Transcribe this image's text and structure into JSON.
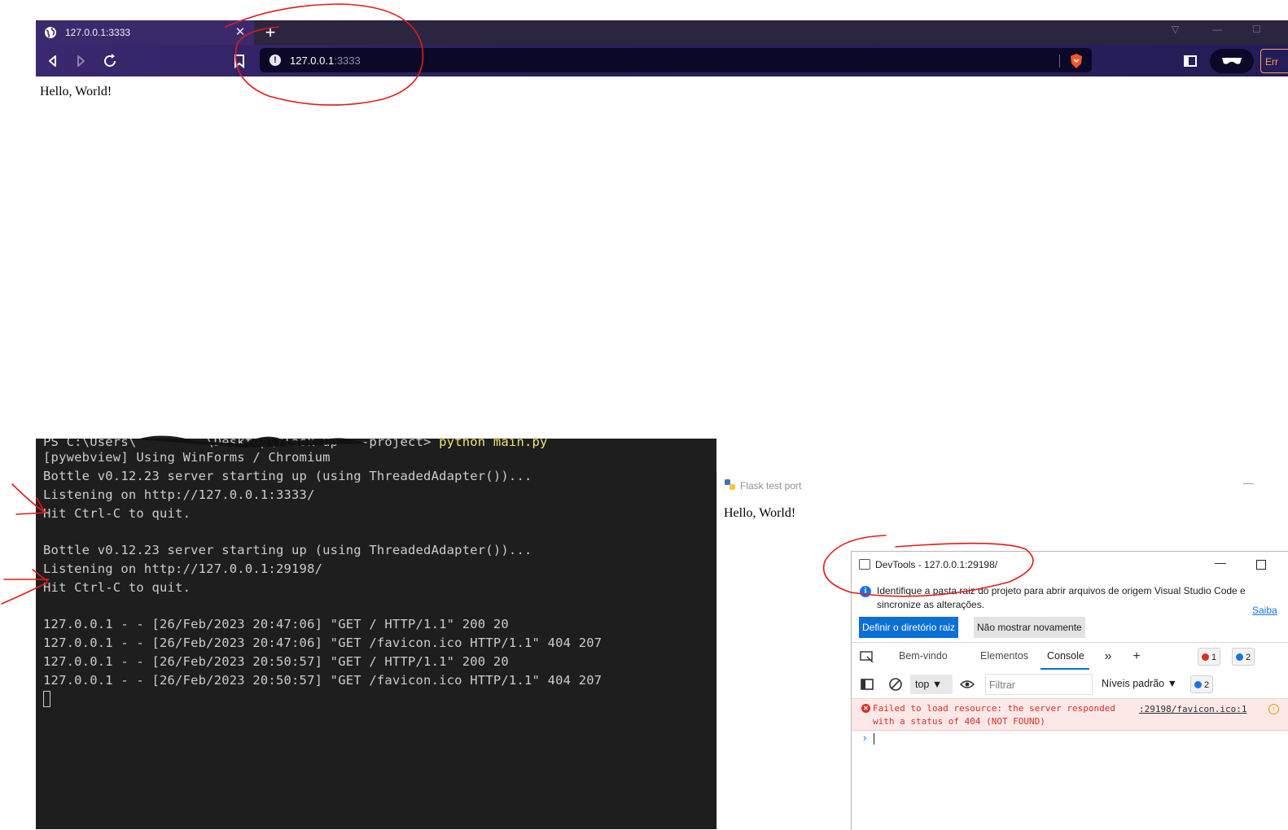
{
  "browser": {
    "tab_title": "127.0.0.1:3333",
    "tab_close": "✕",
    "new_tab": "+",
    "url_host": "127.0.0.1",
    "url_port": ":3333",
    "ext_label": "Err",
    "page_text": "Hello, World!",
    "icons": [
      "globe-icon",
      "back-icon",
      "forward-icon",
      "reload-icon",
      "bookmark-icon",
      "info-icon",
      "brave-shield-icon",
      "sidebar-icon",
      "wallet-icon"
    ]
  },
  "terminal": {
    "lines": [
      "PS C:\\Users\\         \\Desktop\\flask-up   -project> ",
      "[pywebview] Using WinForms / Chromium",
      "Bottle v0.12.23 server starting up (using ThreadedAdapter())...",
      "Listening on http://127.0.0.1:3333/",
      "Hit Ctrl-C to quit.",
      "",
      "Bottle v0.12.23 server starting up (using ThreadedAdapter())...",
      "Listening on http://127.0.0.1:29198/",
      "Hit Ctrl-C to quit.",
      "",
      "127.0.0.1 - - [26/Feb/2023 20:47:06] \"GET / HTTP/1.1\" 200 20",
      "127.0.0.1 - - [26/Feb/2023 20:47:06] \"GET /favicon.ico HTTP/1.1\" 404 207",
      "127.0.0.1 - - [26/Feb/2023 20:50:57] \"GET / HTTP/1.1\" 200 20",
      "127.0.0.1 - - [26/Feb/2023 20:50:57] \"GET /favicon.ico HTTP/1.1\" 404 207"
    ],
    "command": "python main.py"
  },
  "flask": {
    "title": "Flask test port",
    "minimize": "—",
    "page_text": "Hello, World!"
  },
  "devtools": {
    "title": "DevTools - 127.0.0.1:29198/",
    "minimize": "—",
    "info_text": "Identifique a pasta raiz do projeto para abrir arquivos de origem Visual Studio Code e sincronize as alterações.",
    "info_link": "Saiba",
    "btn_set_root": "Definir o diretório raiz",
    "btn_dont_show": "Não mostrar novamente",
    "tabs": {
      "welcome": "Bem-vindo",
      "elements": "Elementos",
      "console": "Console"
    },
    "more_tabs": "»",
    "add_tab": "+",
    "error_count": "1",
    "message_count": "2",
    "context": "top",
    "filter_placeholder": "Filtrar",
    "levels": "Níveis padrão",
    "levels_count": "2",
    "error_message": "Failed to load resource: the server responded with a status of 404 (NOT FOUND)",
    "error_source": ":29198/favicon.ico:1",
    "prompt": "›"
  },
  "colors": {
    "browser_tab": "#3b2a6b",
    "browser_toolbar": "#27205a",
    "terminal_bg": "#1e1e1e",
    "accent": "#0b6fd6",
    "error": "#d93025",
    "annotation": "#e31b1b"
  }
}
